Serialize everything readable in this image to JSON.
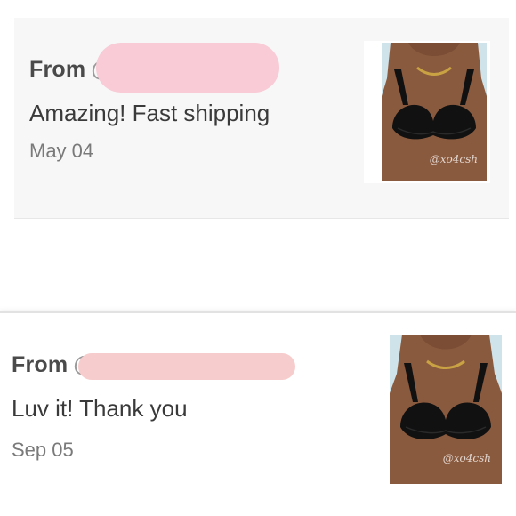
{
  "reviews": [
    {
      "from_label": "From",
      "at_symbol": "@",
      "text": "Amazing! Fast shipping",
      "date": "May 04",
      "photo_watermark": "@xo4csh"
    },
    {
      "from_label": "From",
      "at_symbol": "@",
      "text": "Luv it! Thank you",
      "date": "Sep 05",
      "photo_watermark": "@xo4csh"
    }
  ],
  "colors": {
    "redaction_pink": "#f8cbd6",
    "card_background": "#f7f7f7",
    "photo_background": "#cfe3ea",
    "garment": "#111111"
  }
}
